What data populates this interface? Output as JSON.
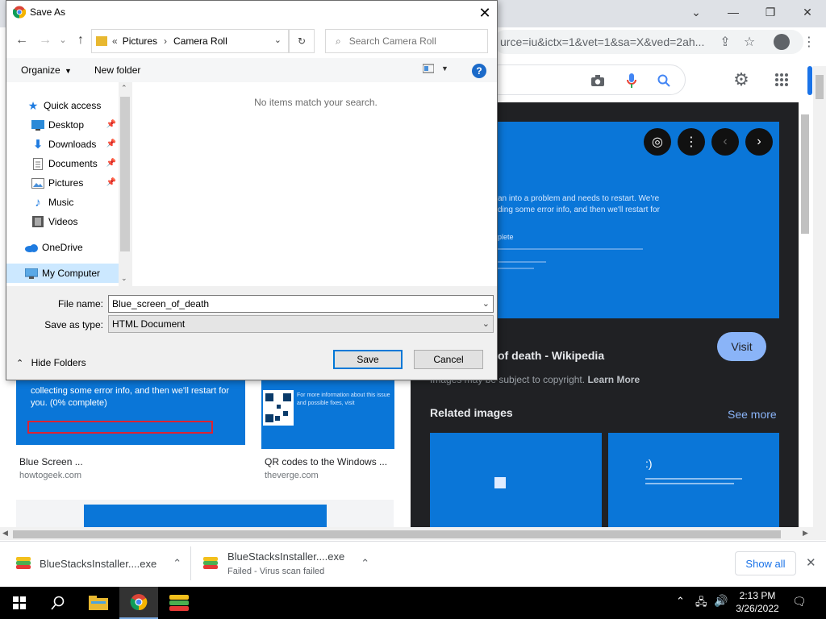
{
  "dialog": {
    "title": "Save As",
    "breadcrumb": {
      "overflow": "«",
      "items": [
        "Pictures",
        "Camera Roll"
      ]
    },
    "search_placeholder": "Search Camera Roll",
    "toolbar": {
      "organize": "Organize",
      "new_folder": "New folder"
    },
    "nav": {
      "quick_access": "Quick access",
      "items": [
        {
          "label": "Desktop",
          "pinned": true
        },
        {
          "label": "Downloads",
          "pinned": true
        },
        {
          "label": "Documents",
          "pinned": true
        },
        {
          "label": "Pictures",
          "pinned": true
        },
        {
          "label": "Music",
          "pinned": false
        },
        {
          "label": "Videos",
          "pinned": false
        }
      ],
      "onedrive": "OneDrive",
      "my_computer": "My Computer"
    },
    "empty_message": "No items match your search.",
    "file_name_label": "File name:",
    "file_name_value": "Blue_screen_of_death",
    "save_type_label": "Save as type:",
    "save_type_value": "HTML Document",
    "hide_folders": "Hide Folders",
    "save_button": "Save",
    "cancel_button": "Cancel"
  },
  "browser": {
    "url_fragment": "urce=iu&ictx=1&vet=1&sa=X&ved=2ah..."
  },
  "preview": {
    "bsod_lines": [
      "an into a problem and needs to restart. We're",
      "ding some error info, and then we'll restart for",
      "plete"
    ],
    "title": "of death - Wikipedia",
    "visit": "Visit",
    "copyright_prefix": "Images may be subject to copyright.",
    "learn_more": "Learn More",
    "related_title": "Related images",
    "see_more": "See more"
  },
  "results": [
    {
      "caption": "Blue Screen ...",
      "source": "howtogeek.com",
      "thumb_text": "collecting some error info, and then we'll restart for you. (0% complete)"
    },
    {
      "caption": "QR codes to the Windows ...",
      "source": "theverge.com",
      "thumb_text": "For more information about this issue and possible fixes, visit"
    }
  ],
  "downloads": [
    {
      "name": "BlueStacksInstaller....exe",
      "status": ""
    },
    {
      "name": "BlueStacksInstaller....exe",
      "status": "Failed - Virus scan failed"
    }
  ],
  "show_all": "Show all",
  "taskbar": {
    "time": "2:13 PM",
    "date": "3/26/2022"
  },
  "colors": {
    "bsod_blue": "#0a76d8",
    "dark_panel": "#202124",
    "link_blue": "#8ab4f8"
  }
}
